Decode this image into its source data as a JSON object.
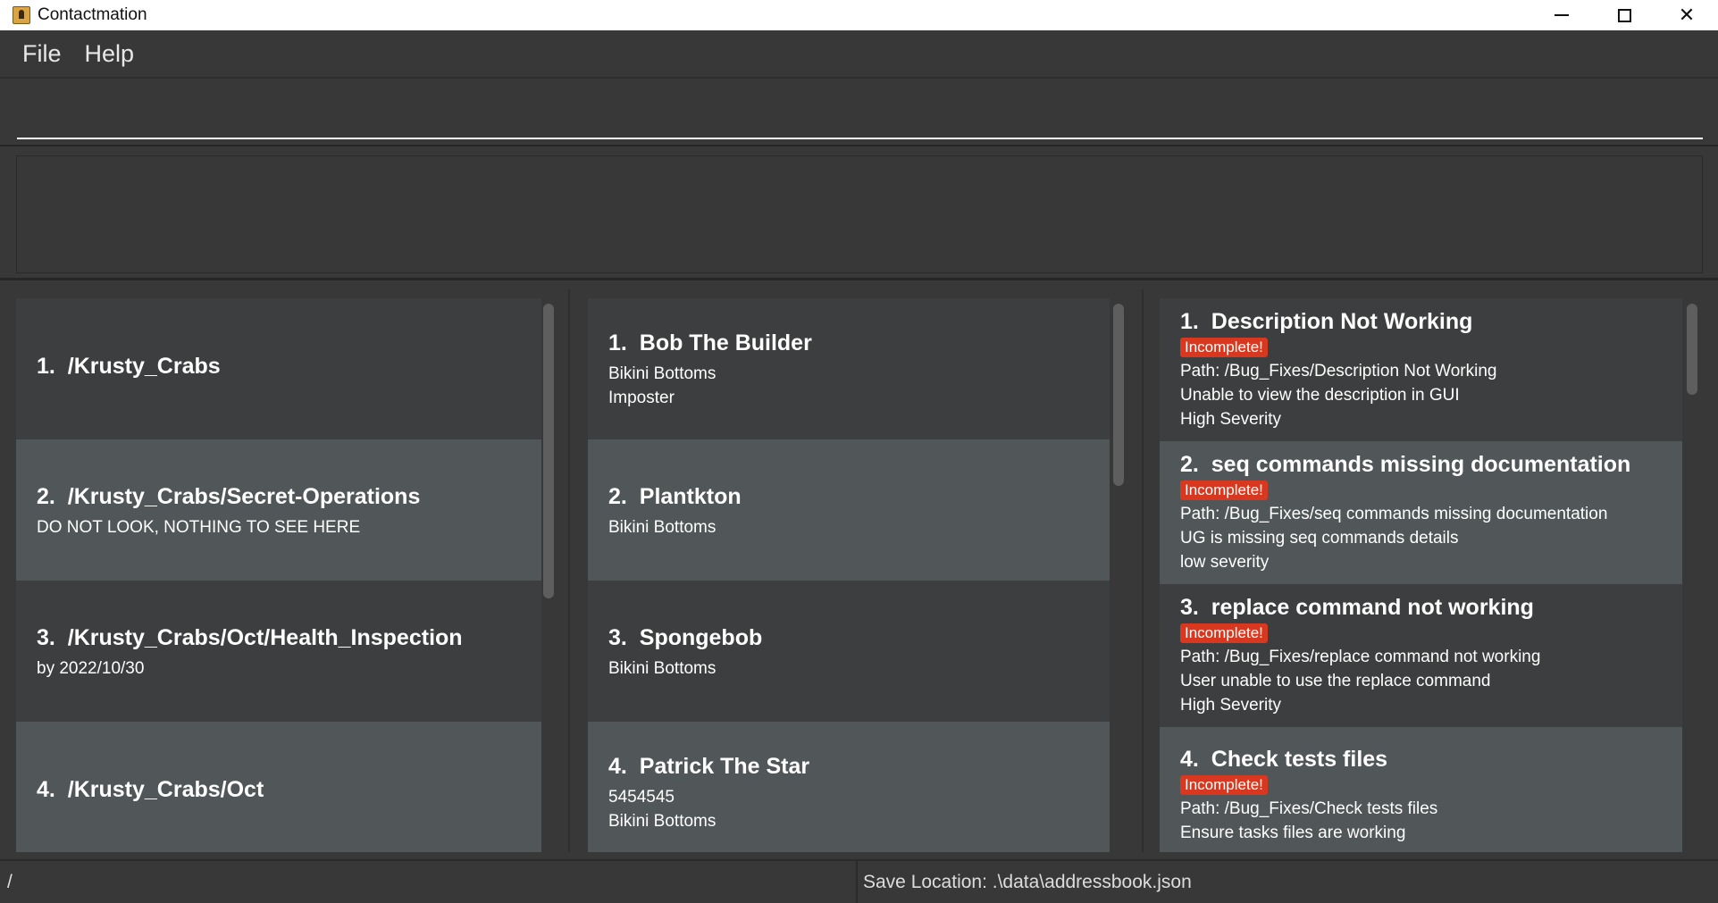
{
  "window": {
    "title": "Contactmation"
  },
  "menu": {
    "items": [
      "File",
      "Help"
    ]
  },
  "command": {
    "value": "",
    "placeholder": ""
  },
  "result": {
    "text": ""
  },
  "groups": [
    {
      "index": "1.",
      "name": "/Krusty_Crabs",
      "lines": []
    },
    {
      "index": "2.",
      "name": "/Krusty_Crabs/Secret-Operations",
      "lines": [
        "DO NOT LOOK, NOTHING TO SEE HERE"
      ]
    },
    {
      "index": "3.",
      "name": "/Krusty_Crabs/Oct/Health_Inspection",
      "lines": [
        "by 2022/10/30"
      ]
    },
    {
      "index": "4.",
      "name": "/Krusty_Crabs/Oct",
      "lines": []
    }
  ],
  "persons": [
    {
      "index": "1.",
      "name": "Bob The Builder",
      "lines": [
        "Bikini Bottoms",
        "Imposter"
      ]
    },
    {
      "index": "2.",
      "name": "Plantkton",
      "lines": [
        "Bikini Bottoms"
      ]
    },
    {
      "index": "3.",
      "name": "Spongebob",
      "lines": [
        "Bikini Bottoms"
      ]
    },
    {
      "index": "4.",
      "name": "Patrick The Star",
      "lines": [
        "5454545",
        "Bikini Bottoms"
      ]
    }
  ],
  "tasks": [
    {
      "index": "1.",
      "name": "Description Not Working",
      "status": "Incomplete!",
      "path": "Path: /Bug_Fixes/Description Not Working",
      "lines": [
        "Unable to view the description in GUI",
        "High Severity"
      ]
    },
    {
      "index": "2.",
      "name": "seq commands missing documentation",
      "status": "Incomplete!",
      "path": "Path: /Bug_Fixes/seq commands missing documentation",
      "lines": [
        "UG is missing seq commands details",
        "low severity"
      ]
    },
    {
      "index": "3.",
      "name": "replace command not working",
      "status": "Incomplete!",
      "path": "Path: /Bug_Fixes/replace command not working",
      "lines": [
        "User unable to use the replace command",
        "High Severity"
      ]
    },
    {
      "index": "4.",
      "name": "Check tests files",
      "status": "Incomplete!",
      "path": "Path: /Bug_Fixes/Check tests files",
      "lines": [
        "Ensure tasks files are working"
      ]
    }
  ],
  "status": {
    "path": "/",
    "save_location": "Save Location: .\\data\\addressbook.json"
  },
  "colors": {
    "background": "#383838",
    "card_dark": "#3c3e3f",
    "card_light": "#515658",
    "badge": "#d8381f"
  }
}
